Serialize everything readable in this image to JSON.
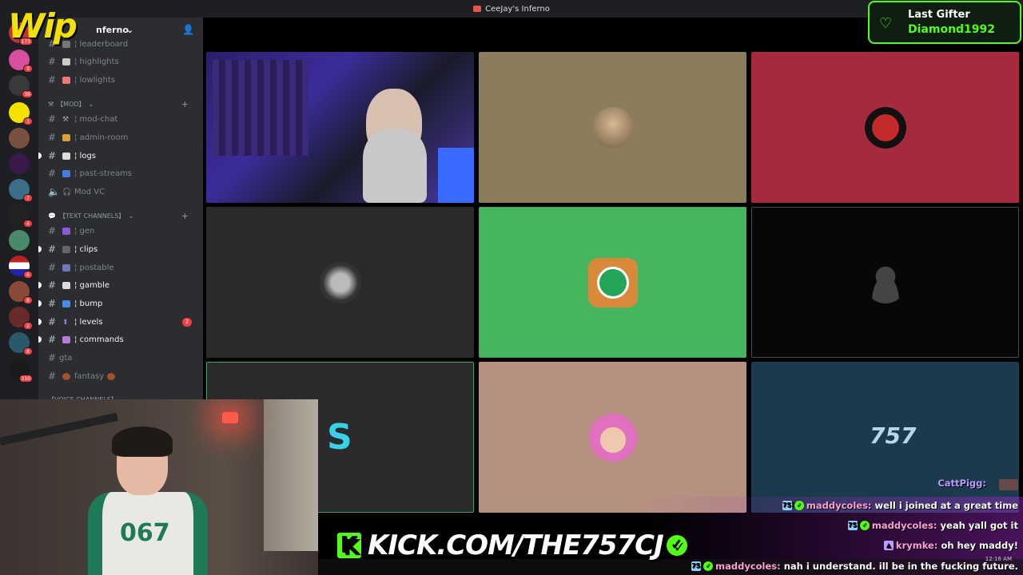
{
  "window": {
    "title": "CeeJay's Inferno"
  },
  "logo": {
    "text": "Wip"
  },
  "server": {
    "name": "nferno"
  },
  "rail": {
    "servers": [
      {
        "badge": ""
      },
      {
        "badge": "3"
      },
      {
        "badge": "36"
      },
      {
        "badge": "3"
      },
      {
        "badge": ""
      },
      {
        "badge": ""
      },
      {
        "badge": "7"
      },
      {
        "badge": "4"
      },
      {
        "badge": ""
      },
      {
        "badge": "6"
      },
      {
        "badge": "8"
      },
      {
        "badge": "2"
      },
      {
        "badge": "8"
      },
      {
        "badge": "310"
      }
    ],
    "top_badge": "173"
  },
  "channels": {
    "top": [
      {
        "name": "¦ leaderboard"
      },
      {
        "name": "¦ highlights"
      },
      {
        "name": "¦ lowlights"
      }
    ],
    "mod_category": "【MOD】",
    "mod": [
      {
        "name": "¦ mod-chat"
      },
      {
        "name": "¦ admin-room"
      },
      {
        "name": "¦ logs"
      },
      {
        "name": "¦ past-streams"
      },
      {
        "name": "Mod VC"
      }
    ],
    "text_category": "【TEXT CHANNELS】",
    "text": [
      {
        "name": "¦ gen"
      },
      {
        "name": "¦ clips"
      },
      {
        "name": "¦ postable"
      },
      {
        "name": "¦ gamble"
      },
      {
        "name": "¦ bump"
      },
      {
        "name": "¦ levels",
        "mentions": "2"
      },
      {
        "name": "¦ commands"
      },
      {
        "name": "gta"
      },
      {
        "name": "fantasy"
      }
    ],
    "voice_category": "【VOICE CHANNELS】"
  },
  "gifter": {
    "label": "Last Gifter",
    "name": "Diamond1992"
  },
  "chat": {
    "top_user": "CattPigg:",
    "lines": [
      {
        "user": "maddycoles:",
        "msg": "well i joined at a great time"
      },
      {
        "user": "maddycoles:",
        "msg": "yeah yall got it"
      },
      {
        "user": "krymke:",
        "msg": "oh hey maddy!"
      },
      {
        "user": "maddycoles:",
        "msg": "nah i understand. ill be in the fucking future."
      }
    ]
  },
  "kick": {
    "url": "KICK.COM/THE757CJ"
  },
  "clock": "12:16 AM",
  "colors": {
    "kick_green": "#53fc18",
    "discord_bg": "#2b2d31",
    "rail_bg": "#1e1f22"
  }
}
